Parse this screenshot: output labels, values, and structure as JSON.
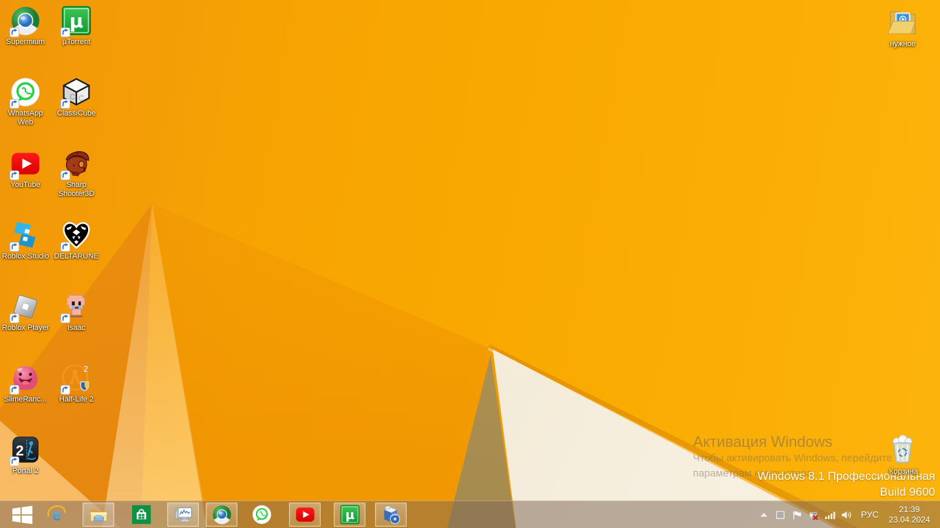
{
  "desktop": {
    "icons": [
      {
        "id": "supermium",
        "label": "Supermium",
        "icon": "chrome-globe-icon",
        "col": 1,
        "row": 1
      },
      {
        "id": "utorrent",
        "label": "µTorrent",
        "icon": "utorrent-icon",
        "col": 2,
        "row": 1
      },
      {
        "id": "whatsapp-web",
        "label": "WhatsApp Web",
        "icon": "whatsapp-icon",
        "col": 1,
        "row": 2
      },
      {
        "id": "classicube",
        "label": "ClassiCube",
        "icon": "classicube-icon",
        "col": 2,
        "row": 2
      },
      {
        "id": "youtube",
        "label": "YouTube",
        "icon": "youtube-icon",
        "col": 1,
        "row": 3
      },
      {
        "id": "sharp-shooter",
        "label": "Sharp Shooter3D",
        "icon": "sharp-shooter-icon",
        "col": 2,
        "row": 3
      },
      {
        "id": "roblox-studio",
        "label": "Roblox Studio",
        "icon": "roblox-studio-icon",
        "col": 1,
        "row": 4
      },
      {
        "id": "deltarune",
        "label": "DELTARUNE",
        "icon": "deltarune-icon",
        "col": 2,
        "row": 4
      },
      {
        "id": "roblox-player",
        "label": "Roblox Player",
        "icon": "roblox-player-icon",
        "col": 1,
        "row": 5
      },
      {
        "id": "isaac",
        "label": "Isaac",
        "icon": "isaac-icon",
        "col": 2,
        "row": 5
      },
      {
        "id": "slime-rancher",
        "label": "SlimeRanc...",
        "icon": "slime-icon",
        "col": 1,
        "row": 6
      },
      {
        "id": "half-life-2",
        "label": "Half-Life 2",
        "icon": "half-life-2-icon",
        "col": 2,
        "row": 6
      },
      {
        "id": "portal-2",
        "label": "Portal 2",
        "icon": "portal-2-icon",
        "col": 1,
        "row": 7
      }
    ],
    "folder_top_right": {
      "label": "нужное",
      "icon": "media-folder-icon"
    },
    "recycle_bin": {
      "label": "Корзина",
      "icon": "recycle-bin-icon"
    }
  },
  "watermark": {
    "title": "Активация Windows",
    "line1": "Чтобы активировать Windows, перейдите к",
    "line2": "параметрам компьютера.",
    "edition": "Windows 8.1 Профессиональная",
    "build": "Build 9600"
  },
  "taskbar": {
    "start_icon": "windows-start-icon",
    "items": [
      {
        "id": "internet-explorer",
        "icon": "ie-icon",
        "running": false
      },
      {
        "id": "file-explorer",
        "icon": "file-explorer-icon",
        "running": true
      },
      {
        "id": "windows-store",
        "icon": "windows-store-icon",
        "running": false
      },
      {
        "id": "system-monitor",
        "icon": "system-monitor-icon",
        "running": true
      },
      {
        "id": "supermium",
        "icon": "chrome-globe-icon",
        "running": true
      },
      {
        "id": "whatsapp",
        "icon": "whatsapp-icon",
        "running": false
      },
      {
        "id": "youtube",
        "icon": "youtube-icon",
        "running": true
      },
      {
        "id": "utorrent",
        "icon": "utorrent-icon",
        "running": true
      },
      {
        "id": "installer",
        "icon": "software-box-icon",
        "running": true
      }
    ],
    "tray": {
      "icons": [
        {
          "id": "show-hidden-icons",
          "icon": "chevron-up-icon"
        },
        {
          "id": "window-grid",
          "icon": "window-grid-icon"
        },
        {
          "id": "action-center",
          "icon": "flag-icon"
        },
        {
          "id": "device-error",
          "icon": "plug-error-icon"
        },
        {
          "id": "network",
          "icon": "signal-bars-icon"
        },
        {
          "id": "volume",
          "icon": "speaker-icon"
        }
      ],
      "language": "РУС",
      "time": "21:39",
      "date": "23.04.2024"
    }
  },
  "colors": {
    "wallpaper_amber": "#f9a900",
    "wallpaper_dark_orange": "#e28010",
    "wallpaper_cream": "#f2e8d3",
    "wallpaper_tan": "#b09450",
    "taskbar_tint": "rgba(128,106,90,0.52)"
  }
}
